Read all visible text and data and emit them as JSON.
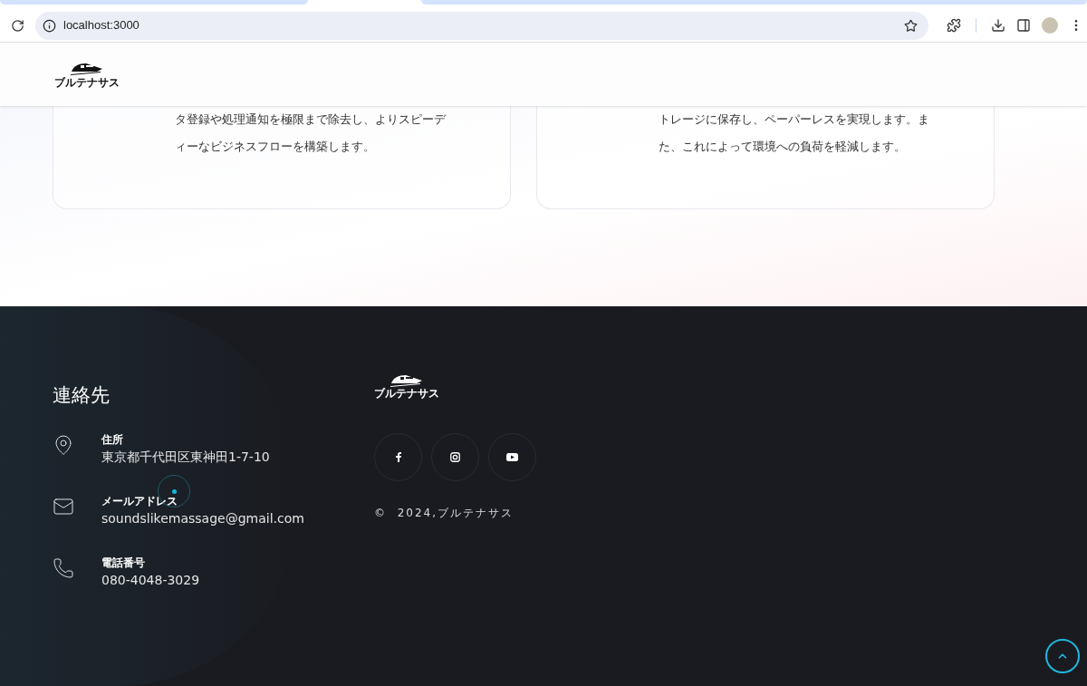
{
  "browser": {
    "url": "localhost:3000"
  },
  "header": {
    "logo_text": "ブルテナサス"
  },
  "cards": [
    {
      "lines": [
        "タ登録や処理通知を極限まで除去し、よりスピーデ",
        "ィーなビジネスフローを構築します。"
      ]
    },
    {
      "lines": [
        "トレージに保存し、ペーパーレスを実現します。ま",
        "た、これによって環境への負荷を軽減します。"
      ]
    }
  ],
  "footer": {
    "contact_title": "連絡先",
    "contacts": [
      {
        "kind": "address",
        "label": "住所",
        "value": "東京都千代田区東神田1-7-10"
      },
      {
        "kind": "email",
        "label": "メールアドレス",
        "value": "soundslikemassage@gmail.com"
      },
      {
        "kind": "phone",
        "label": "電話番号",
        "value": "080-4048-3029"
      }
    ],
    "logo_text": "ブルテナサス",
    "socials": [
      {
        "kind": "facebook"
      },
      {
        "kind": "instagram"
      },
      {
        "kind": "youtube"
      }
    ],
    "copyright": "©  2024,ブルテナサス"
  }
}
